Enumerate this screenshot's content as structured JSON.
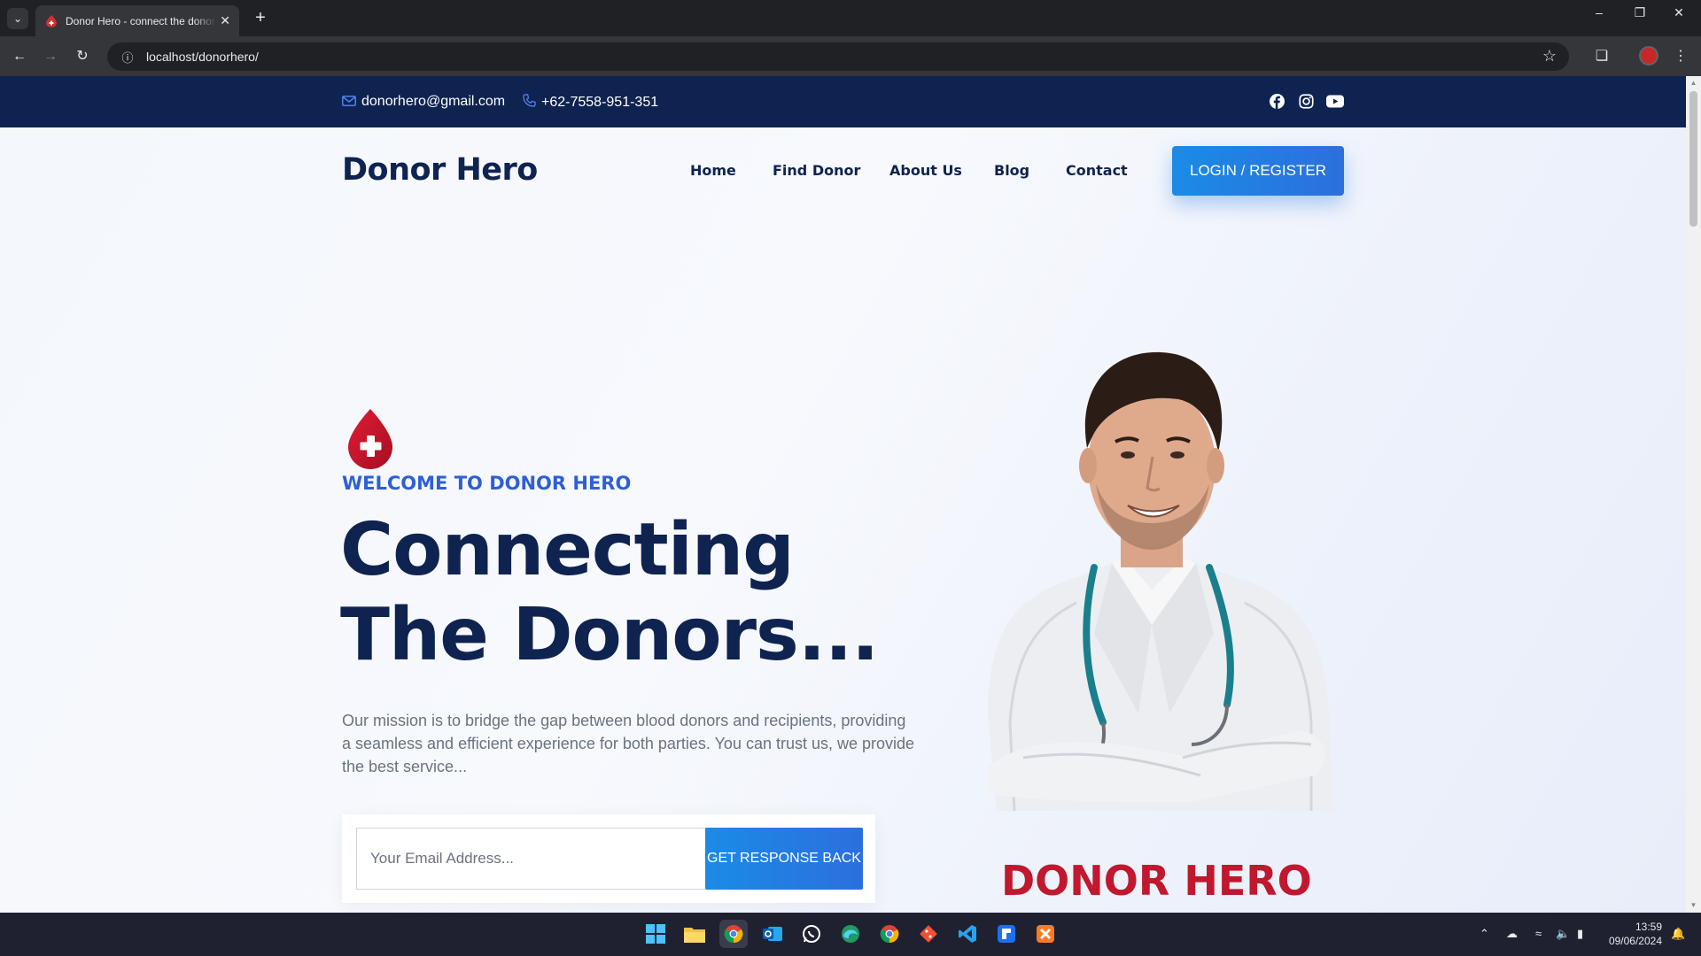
{
  "browser": {
    "tab_title": "Donor Hero - connect the donor",
    "new_tab": "+",
    "url": "localhost/donorhero/",
    "window_controls": {
      "minimize": "–",
      "restore": "❐",
      "close": "✕"
    }
  },
  "topbar": {
    "email": "donorhero@gmail.com",
    "phone": "+62-7558-951-351",
    "socials": [
      "facebook",
      "instagram",
      "youtube"
    ]
  },
  "header": {
    "logo": "Donor Hero",
    "nav": [
      "Home",
      "Find Donor",
      "About Us",
      "Blog",
      "Contact"
    ],
    "login_label": "LOGIN / REGISTER"
  },
  "hero": {
    "eyebrow": "WELCOME TO DONOR HERO",
    "title_line1": "Connecting",
    "title_line2": "The Donors...",
    "description": "Our mission is to bridge the gap between blood donors and recipients, providing a seamless and efficient experience for both parties. You can trust us, we provide the best service...",
    "email_placeholder": "Your Email Address...",
    "cta_label": "GET RESPONSE BACK",
    "brand_text": "DONOR HERO"
  },
  "taskbar": {
    "time": "13:59",
    "date": "09/06/2024"
  },
  "colors": {
    "navy": "#0f2350",
    "accent_blue": "#2c6fde",
    "brand_red": "#c0182e"
  }
}
